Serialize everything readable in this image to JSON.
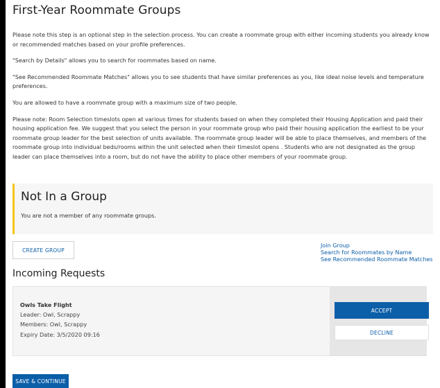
{
  "page": {
    "title": "First-Year Roommate Groups",
    "intro": [
      "Please note this step is an optional step in the selection process. You can create a roommate group with either incoming students you already know or recommended matches based on your profile preferences.",
      "\"Search by Details\" allows you to search for roommates based on name.",
      "\"See Recommended Roommate Matches\" allows you to see students that have similar preferences as you, like ideal noise levels and temperature preferences.",
      "You are allowed to have a roommate group with a maximum size of two people.",
      "Please note: Room Selection timeslots open at various times for students based on when they completed their Housing Application and paid their housing application fee. We suggest that you select the person in your roommate group who paid their housing application the earliest to be your roommate group leader for the best selection of units available. The roommate group leader will be able to place themselves, and members of the roommate group into individual beds/rooms within the unit selected when their timeslot opens . Students who are not designated as the group leader can place themselves into a room, but do not have the ability to place other members of your roommate group."
    ]
  },
  "group_status": {
    "title": "Not In a Group",
    "text": "You are not a member of any roommate groups."
  },
  "actions": {
    "create_group": "CREATE GROUP",
    "links": [
      "Join Group",
      "Search for Roommates by Name",
      "See Recommended Roommate Matches"
    ]
  },
  "incoming_requests": {
    "title": "Incoming Requests",
    "items": [
      {
        "name": "Owls Take Flight",
        "leader": "Leader: Owl, Scrappy",
        "members": "Members: Owl, Scrappy",
        "expiry": "Expiry Date: 3/5/2020 09:16",
        "accept_label": "ACCEPT",
        "decline_label": "DECLINE"
      }
    ]
  },
  "footer": {
    "save_label": "SAVE & CONTINUE"
  },
  "colors": {
    "primary": "#0b5ea8",
    "accent_bar": "#f5c518"
  }
}
